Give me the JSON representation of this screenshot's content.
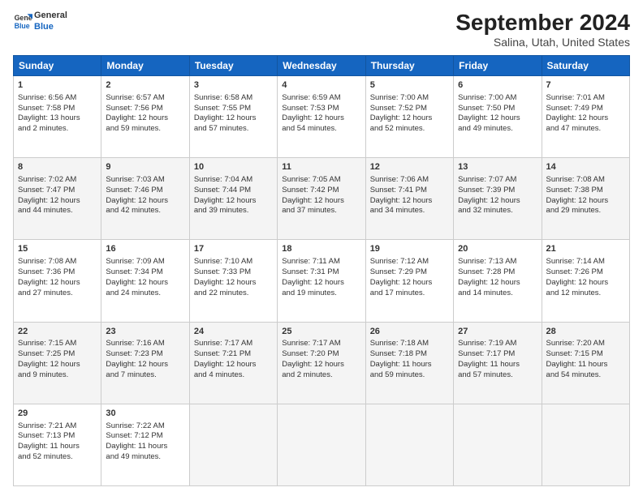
{
  "logo": {
    "line1": "General",
    "line2": "Blue"
  },
  "header": {
    "month": "September 2024",
    "location": "Salina, Utah, United States"
  },
  "weekdays": [
    "Sunday",
    "Monday",
    "Tuesday",
    "Wednesday",
    "Thursday",
    "Friday",
    "Saturday"
  ],
  "weeks": [
    [
      {
        "day": "1",
        "info": "Sunrise: 6:56 AM\nSunset: 7:58 PM\nDaylight: 13 hours\nand 2 minutes."
      },
      {
        "day": "2",
        "info": "Sunrise: 6:57 AM\nSunset: 7:56 PM\nDaylight: 12 hours\nand 59 minutes."
      },
      {
        "day": "3",
        "info": "Sunrise: 6:58 AM\nSunset: 7:55 PM\nDaylight: 12 hours\nand 57 minutes."
      },
      {
        "day": "4",
        "info": "Sunrise: 6:59 AM\nSunset: 7:53 PM\nDaylight: 12 hours\nand 54 minutes."
      },
      {
        "day": "5",
        "info": "Sunrise: 7:00 AM\nSunset: 7:52 PM\nDaylight: 12 hours\nand 52 minutes."
      },
      {
        "day": "6",
        "info": "Sunrise: 7:00 AM\nSunset: 7:50 PM\nDaylight: 12 hours\nand 49 minutes."
      },
      {
        "day": "7",
        "info": "Sunrise: 7:01 AM\nSunset: 7:49 PM\nDaylight: 12 hours\nand 47 minutes."
      }
    ],
    [
      {
        "day": "8",
        "info": "Sunrise: 7:02 AM\nSunset: 7:47 PM\nDaylight: 12 hours\nand 44 minutes."
      },
      {
        "day": "9",
        "info": "Sunrise: 7:03 AM\nSunset: 7:46 PM\nDaylight: 12 hours\nand 42 minutes."
      },
      {
        "day": "10",
        "info": "Sunrise: 7:04 AM\nSunset: 7:44 PM\nDaylight: 12 hours\nand 39 minutes."
      },
      {
        "day": "11",
        "info": "Sunrise: 7:05 AM\nSunset: 7:42 PM\nDaylight: 12 hours\nand 37 minutes."
      },
      {
        "day": "12",
        "info": "Sunrise: 7:06 AM\nSunset: 7:41 PM\nDaylight: 12 hours\nand 34 minutes."
      },
      {
        "day": "13",
        "info": "Sunrise: 7:07 AM\nSunset: 7:39 PM\nDaylight: 12 hours\nand 32 minutes."
      },
      {
        "day": "14",
        "info": "Sunrise: 7:08 AM\nSunset: 7:38 PM\nDaylight: 12 hours\nand 29 minutes."
      }
    ],
    [
      {
        "day": "15",
        "info": "Sunrise: 7:08 AM\nSunset: 7:36 PM\nDaylight: 12 hours\nand 27 minutes."
      },
      {
        "day": "16",
        "info": "Sunrise: 7:09 AM\nSunset: 7:34 PM\nDaylight: 12 hours\nand 24 minutes."
      },
      {
        "day": "17",
        "info": "Sunrise: 7:10 AM\nSunset: 7:33 PM\nDaylight: 12 hours\nand 22 minutes."
      },
      {
        "day": "18",
        "info": "Sunrise: 7:11 AM\nSunset: 7:31 PM\nDaylight: 12 hours\nand 19 minutes."
      },
      {
        "day": "19",
        "info": "Sunrise: 7:12 AM\nSunset: 7:29 PM\nDaylight: 12 hours\nand 17 minutes."
      },
      {
        "day": "20",
        "info": "Sunrise: 7:13 AM\nSunset: 7:28 PM\nDaylight: 12 hours\nand 14 minutes."
      },
      {
        "day": "21",
        "info": "Sunrise: 7:14 AM\nSunset: 7:26 PM\nDaylight: 12 hours\nand 12 minutes."
      }
    ],
    [
      {
        "day": "22",
        "info": "Sunrise: 7:15 AM\nSunset: 7:25 PM\nDaylight: 12 hours\nand 9 minutes."
      },
      {
        "day": "23",
        "info": "Sunrise: 7:16 AM\nSunset: 7:23 PM\nDaylight: 12 hours\nand 7 minutes."
      },
      {
        "day": "24",
        "info": "Sunrise: 7:17 AM\nSunset: 7:21 PM\nDaylight: 12 hours\nand 4 minutes."
      },
      {
        "day": "25",
        "info": "Sunrise: 7:17 AM\nSunset: 7:20 PM\nDaylight: 12 hours\nand 2 minutes."
      },
      {
        "day": "26",
        "info": "Sunrise: 7:18 AM\nSunset: 7:18 PM\nDaylight: 11 hours\nand 59 minutes."
      },
      {
        "day": "27",
        "info": "Sunrise: 7:19 AM\nSunset: 7:17 PM\nDaylight: 11 hours\nand 57 minutes."
      },
      {
        "day": "28",
        "info": "Sunrise: 7:20 AM\nSunset: 7:15 PM\nDaylight: 11 hours\nand 54 minutes."
      }
    ],
    [
      {
        "day": "29",
        "info": "Sunrise: 7:21 AM\nSunset: 7:13 PM\nDaylight: 11 hours\nand 52 minutes."
      },
      {
        "day": "30",
        "info": "Sunrise: 7:22 AM\nSunset: 7:12 PM\nDaylight: 11 hours\nand 49 minutes."
      },
      {
        "day": "",
        "info": ""
      },
      {
        "day": "",
        "info": ""
      },
      {
        "day": "",
        "info": ""
      },
      {
        "day": "",
        "info": ""
      },
      {
        "day": "",
        "info": ""
      }
    ]
  ]
}
